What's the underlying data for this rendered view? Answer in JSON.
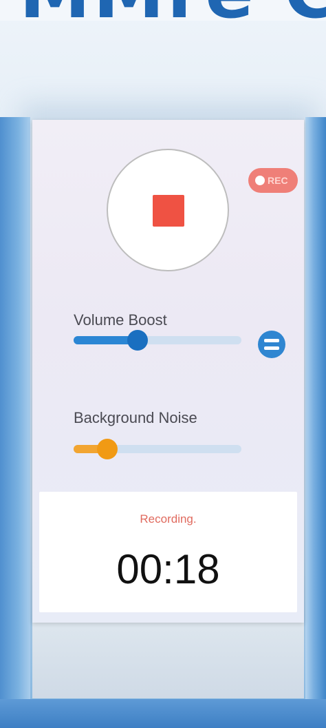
{
  "banner": {
    "letters": "MMre C"
  },
  "recorder": {
    "rec_badge": "REC",
    "stop_color": "#ef5243"
  },
  "sliders": {
    "volume": {
      "label": "Volume Boost",
      "value": 0.38,
      "color": "#2b86d4"
    },
    "noise": {
      "label": "Background Noise",
      "value": 0.2,
      "color": "#f2a531"
    }
  },
  "status": {
    "state": "Recording.",
    "timer": "00:18"
  },
  "icons": {
    "record": "stop-square-icon",
    "rec": "rec-dot-icon",
    "equalizer": "equalizer-icon"
  }
}
